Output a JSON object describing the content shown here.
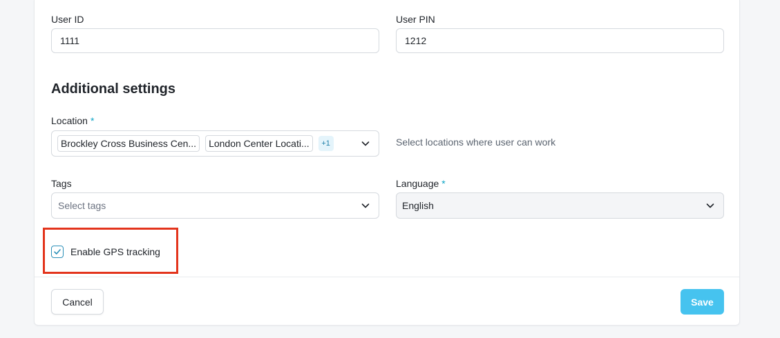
{
  "fields": {
    "user_id": {
      "label": "User ID",
      "value": "1111"
    },
    "user_pin": {
      "label": "User PIN",
      "value": "1212"
    }
  },
  "section": {
    "title": "Additional settings"
  },
  "location": {
    "label": "Location",
    "required_mark": "*",
    "chips": [
      "Brockley Cross Business Cen...",
      "London Center Locati..."
    ],
    "more_count": "+1",
    "hint": "Select locations where user can work"
  },
  "tags": {
    "label": "Tags",
    "placeholder": "Select tags"
  },
  "language": {
    "label": "Language",
    "required_mark": "*",
    "value": "English"
  },
  "gps": {
    "label": "Enable GPS tracking",
    "checked": true
  },
  "footer": {
    "cancel_label": "Cancel",
    "save_label": "Save"
  },
  "colors": {
    "accent": "#46c3ef",
    "required": "#0ea5c6",
    "highlight": "#e3341c"
  },
  "icons": {
    "chevron": "chevron-down-icon",
    "check": "check-icon"
  }
}
